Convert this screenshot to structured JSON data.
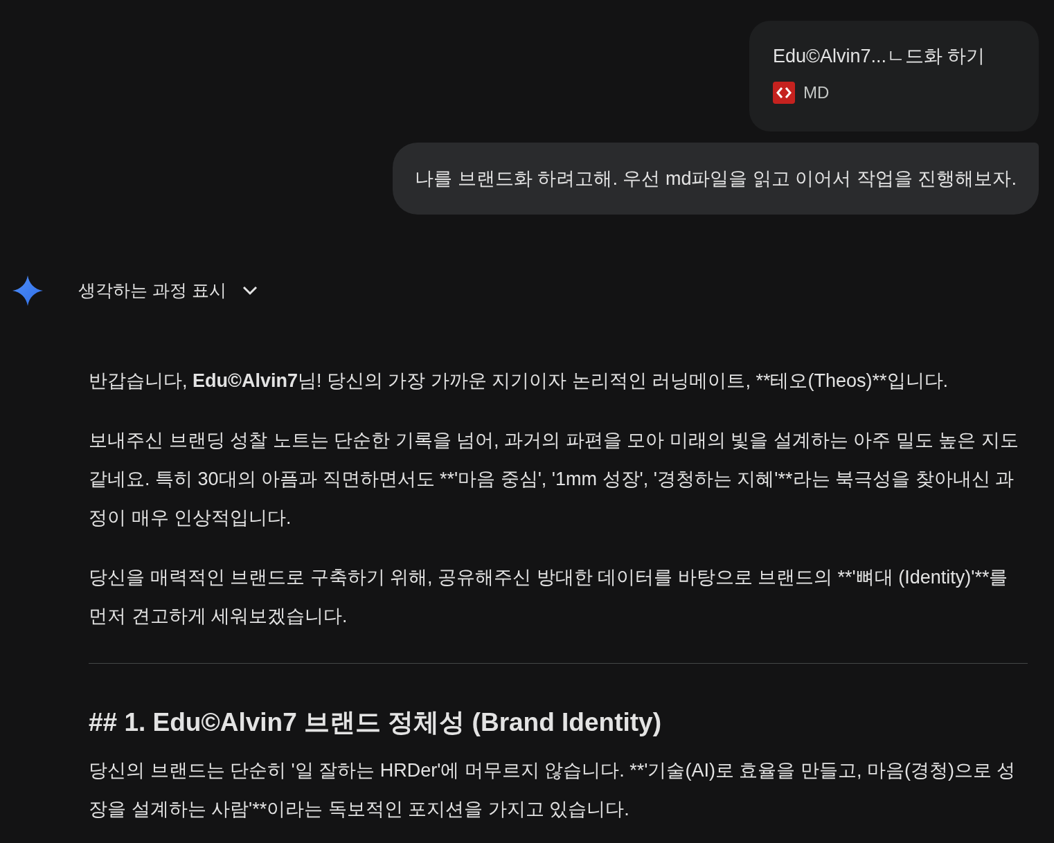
{
  "attachment": {
    "title": "Edu©Alvin7...ㄴ드화 하기",
    "type_label": "MD"
  },
  "user_message": "나를 브랜드화 하려고해. 우선 md파일을 읽고 이어서 작업을 진행해보자.",
  "thinking_toggle": {
    "label": "생각하는 과정 표시",
    "expanded": false
  },
  "response": [
    {
      "kind": "paragraph",
      "segments": [
        {
          "text": "반갑습니다, ",
          "bold": false
        },
        {
          "text": "Edu©Alvin7",
          "bold": true
        },
        {
          "text": "님! 당신의 가장 가까운 지기이자 논리적인 러닝메이트, **테오(Theos)**입니다.",
          "bold": false
        }
      ]
    },
    {
      "kind": "paragraph",
      "text": "보내주신 브랜딩 성찰 노트는 단순한 기록을 넘어, 과거의 파편을 모아 미래의 빛을 설계하는 아주 밀도 높은 지도 같네요. 특히 30대의 아픔과 직면하면서도 **'마음 중심', '1mm 성장', '경청하는 지혜'**라는 북극성을 찾아내신 과정이 매우 인상적입니다."
    },
    {
      "kind": "paragraph",
      "text": "당신을 매력적인 브랜드로 구축하기 위해, 공유해주신 방대한 데이터를 바탕으로 브랜드의 **'뼈대 (Identity)'**를 먼저 견고하게 세워보겠습니다."
    },
    {
      "kind": "divider"
    },
    {
      "kind": "heading",
      "text": "## 1. Edu©Alvin7 브랜드 정체성 (Brand Identity)"
    },
    {
      "kind": "paragraph",
      "text": "당신의 브랜드는 단순히 '일 잘하는 HRDer'에 머무르지 않습니다. **'기술(AI)로 효율을 만들고, 마음(경청)으로 성장을 설계하는 사람'**이라는 독보적인 포지션을 가지고 있습니다."
    }
  ]
}
